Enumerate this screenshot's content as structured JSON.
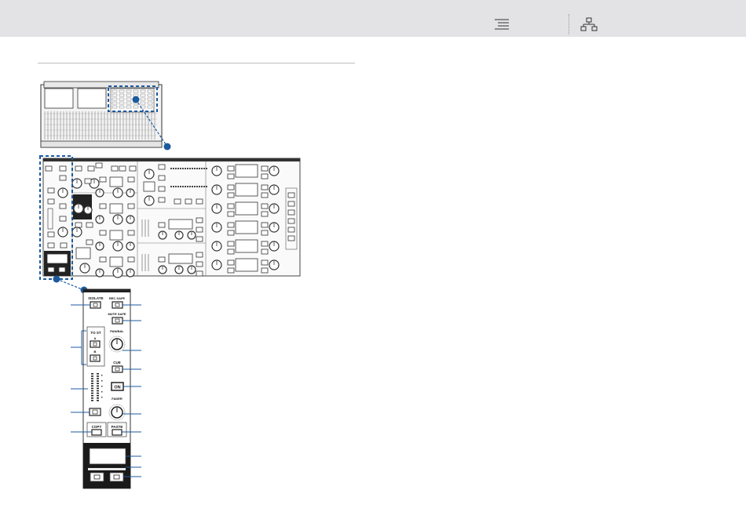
{
  "toolbar": {
    "icons": [
      "contents-icon",
      "sitemap-icon"
    ]
  },
  "figure": {
    "isolate_label": "ISOLATE",
    "rec_safe_label": "REC SAFE",
    "mute_safe_label": "MUTE SAFE",
    "to_st_label": "TO ST",
    "to_st_a_label": "A",
    "to_st_b_label": "B",
    "pan_bal_label": "PAN/BAL",
    "cue_label": "CUE",
    "on_label": "ON",
    "fader_label": "FADER",
    "copy_label": "COPY",
    "paste_label": "PASTE"
  }
}
